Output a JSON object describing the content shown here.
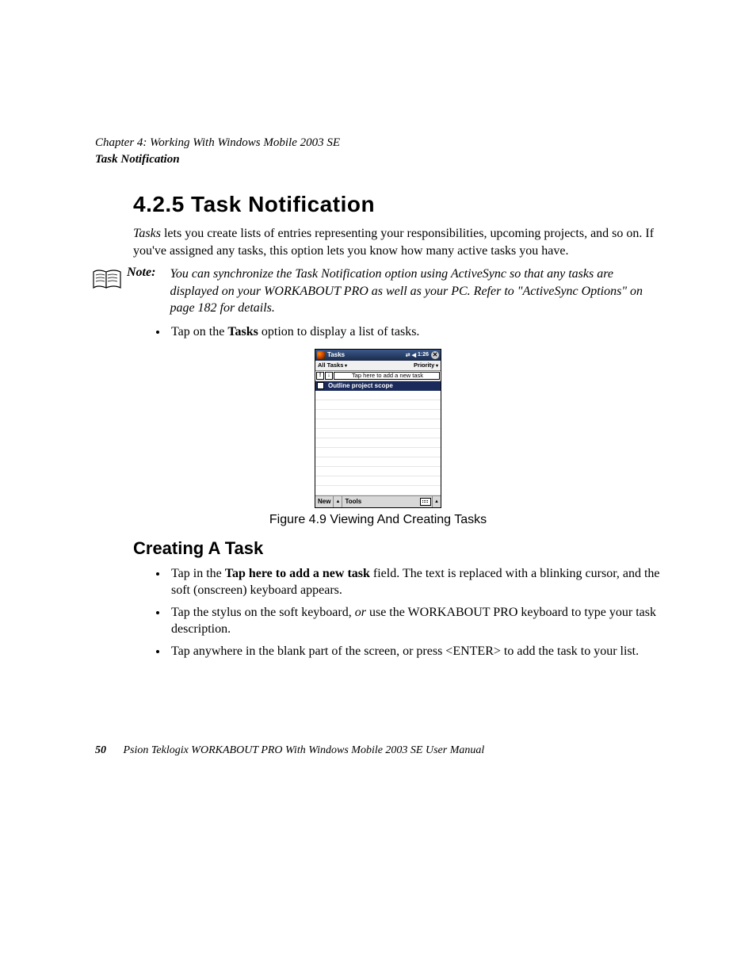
{
  "runningHead": {
    "chapter": "Chapter 4: Working With Windows Mobile 2003 SE",
    "section": "Task Notification"
  },
  "heading": "4.2.5  Task Notification",
  "intro": {
    "lead": "Tasks",
    "rest": " lets you create lists of entries representing your responsibilities, upcoming projects, and so on. If you've assigned any tasks, this option lets you know how many active tasks you have."
  },
  "note": {
    "label": "Note:",
    "text": "You can synchronize the Task Notification option using ActiveSync so that any tasks are displayed on your WORKABOUT PRO as well as your PC. Refer to \"ActiveSync Options\" on page 182 for details."
  },
  "bullet1": {
    "pre": "Tap on the ",
    "bold": "Tasks",
    "post": " option to display a list of tasks."
  },
  "screenshot": {
    "title": "Tasks",
    "time": "1:26",
    "filterLeft": "All Tasks",
    "filterRight": "Priority",
    "priHigh": "!",
    "priLow": "↓",
    "addPlaceholder": "Tap here to add a new task",
    "task1": "Outline project scope",
    "menuNew": "New",
    "menuTools": "Tools"
  },
  "figureCaption": "Figure 4.9 Viewing And Creating Tasks",
  "subheading": "Creating A Task",
  "createBullets": {
    "b1": {
      "pre": "Tap in the ",
      "bold": "Tap here to add a new task",
      "post": " field. The text is replaced with a blinking cursor, and the soft (onscreen) keyboard appears."
    },
    "b2": {
      "pre": "Tap the stylus on the soft keyboard, ",
      "it": "or",
      "post": " use the WORKABOUT PRO keyboard to type your task description."
    },
    "b3": {
      "text": "Tap anywhere in the blank part of the screen, or press <ENTER> to add the task to your list."
    }
  },
  "footer": {
    "page": "50",
    "text": "Psion Teklogix WORKABOUT PRO With Windows Mobile 2003 SE User Manual"
  }
}
